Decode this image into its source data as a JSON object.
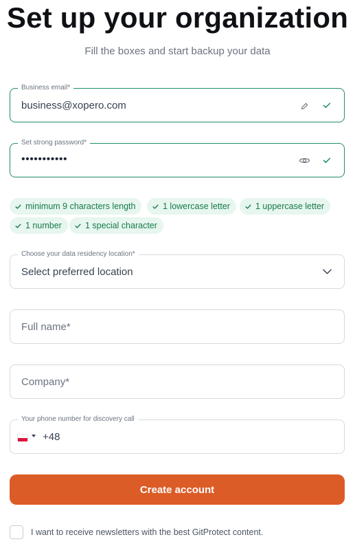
{
  "header": {
    "title": "Set up your organization",
    "subtitle": "Fill the boxes and start backup your data"
  },
  "email": {
    "label": "Business email*",
    "value": "business@xopero.com",
    "edit_icon": "pencil-icon",
    "status_icon": "check-icon"
  },
  "password": {
    "label": "Set strong password*",
    "value": "•••••••••••",
    "toggle_icon": "eye-icon",
    "status_icon": "check-icon"
  },
  "requirements": [
    "minimum 9 characters length",
    "1 lowercase letter",
    "1 uppercase letter",
    "1 number",
    "1 special character"
  ],
  "location": {
    "label": "Choose your data residency location*",
    "placeholder": "Select preferred location"
  },
  "full_name": {
    "placeholder": "Full name*"
  },
  "company": {
    "placeholder": "Company*"
  },
  "phone": {
    "label": "Your phone number for discovery call",
    "country": "PL",
    "code": "+48"
  },
  "actions": {
    "create_label": "Create account"
  },
  "newsletter": {
    "label": "I want to receive newsletters with the best GitProtect content.",
    "checked": false
  },
  "colors": {
    "accent": "#dc5c27",
    "success": "#1f8f62",
    "chip_bg": "#e7f6ee"
  }
}
